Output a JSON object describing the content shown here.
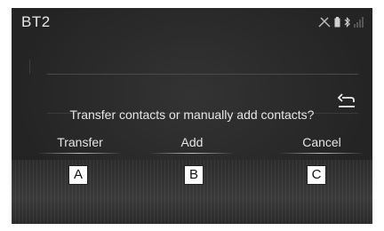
{
  "header": {
    "title": "BT2"
  },
  "status_icons": [
    "no-signal-icon",
    "phone-battery-icon",
    "bluetooth-icon",
    "signal-bars-icon"
  ],
  "back_icon": "return-arrow-icon",
  "dialog": {
    "prompt": "Transfer contacts or manually add contacts?",
    "buttons": {
      "transfer": "Transfer",
      "add": "Add",
      "cancel": "Cancel"
    }
  },
  "callouts": {
    "a": "A",
    "b": "B",
    "c": "C"
  },
  "colors": {
    "screen_bg": "#242424",
    "text": "#e6e6e6"
  }
}
